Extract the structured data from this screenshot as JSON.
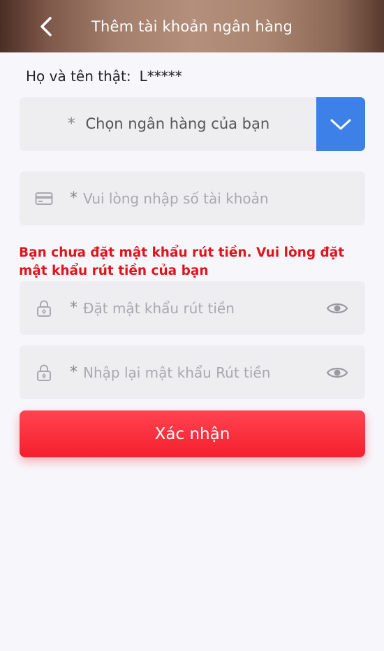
{
  "header": {
    "title": "Thêm tài khoản ngân hàng",
    "back_icon": "chevron-left-icon"
  },
  "real_name": {
    "label": "Họ và tên thật:",
    "value": "L*****"
  },
  "bank_select": {
    "required_mark": "*",
    "label": "Chọn ngân hàng của bạn",
    "dropdown_icon": "chevron-down-icon"
  },
  "account_field": {
    "required_mark": "*",
    "placeholder": "Vui lòng nhập số tài khoản",
    "value": "",
    "icon": "card-icon"
  },
  "warning": "Bạn chưa đặt mật khẩu rút tiền. Vui lòng đặt mật khẩu rút tiền của bạn",
  "password_field": {
    "required_mark": "*",
    "placeholder": "Đặt mật khẩu rút tiền",
    "value": "",
    "icon": "lock-icon"
  },
  "confirm_password_field": {
    "required_mark": "*",
    "placeholder": "Nhập lại mật khẩu Rút tiền",
    "value": "",
    "icon": "lock-icon"
  },
  "confirm_button": {
    "label": "Xác nhận"
  },
  "colors": {
    "accent_blue": "#3d80e8",
    "confirm_red": "#f51f2d",
    "warning_red": "#e0141a"
  }
}
